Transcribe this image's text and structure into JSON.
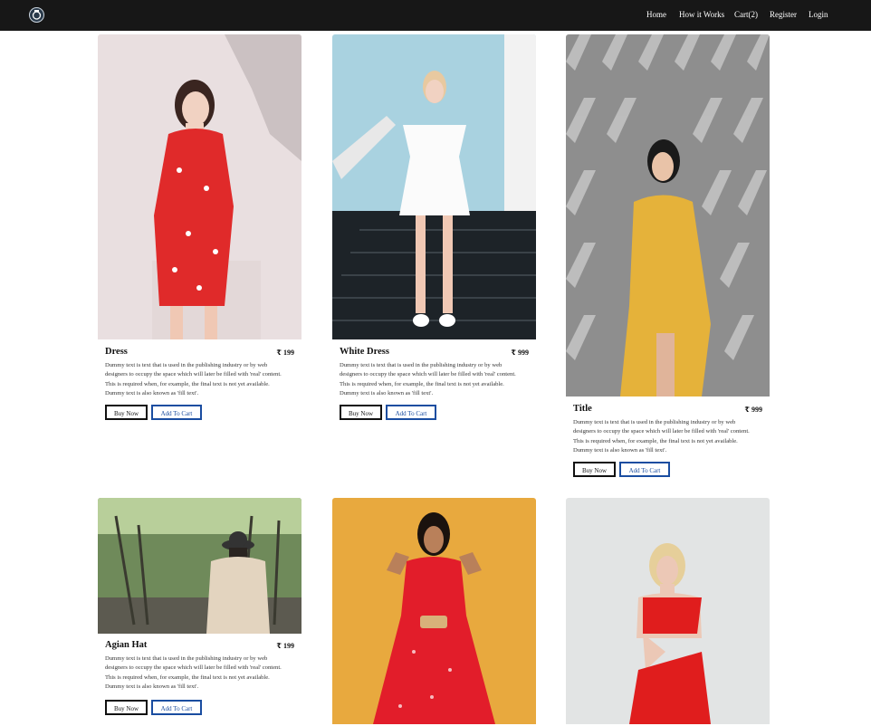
{
  "navbar": {
    "logo_icon": "camera-logo-icon",
    "links": [
      "Home",
      "How it Works",
      "Cart(2)",
      "Register",
      "Login"
    ]
  },
  "products": [
    {
      "title": "Dress",
      "price": "₹ 199",
      "desc": "Dummy text is text that is used in the publishing industry or by web designers to occupy the space which will later be filled with 'real' content. This is required when, for example, the final text is not yet available. Dummy text is also known as 'fill text'.",
      "buy_label": "Buy Now",
      "cart_label": "Add To Cart",
      "image": "woman in red floral dress"
    },
    {
      "title": "White Dress",
      "price": "₹ 999",
      "desc": "Dummy text is text that is used in the publishing industry or by web designers to occupy the space which will later be filled with 'real' content. This is required when, for example, the final text is not yet available. Dummy text is also known as 'fill text'.",
      "buy_label": "Buy Now",
      "cart_label": "Add To Cart",
      "image": "woman in white dress on stairs"
    },
    {
      "title": "Title",
      "price": "₹ 999",
      "desc": "Dummy text is text that is used in the publishing industry or by web designers to occupy the space which will later be filled with 'real' content. This is required when, for example, the final text is not yet available. Dummy text is also known as 'fill text'.",
      "buy_label": "Buy Now",
      "cart_label": "Add To Cart",
      "image": "woman in yellow wrap dress"
    },
    {
      "title": "Agian Hat",
      "price": "₹ 199",
      "desc": "Dummy text is text that is used in the publishing industry or by web designers to occupy the space which will later be filled with 'real' content. This is required when, for example, the final text is not yet available. Dummy text is also known as 'fill text'.",
      "buy_label": "Buy Now",
      "cart_label": "Add To Cart",
      "image": "woman in hat on garden stairs"
    },
    {
      "image": "woman in red dress on yellow background"
    },
    {
      "image": "woman in red one-shoulder top"
    }
  ],
  "colors": {
    "navbar_bg": "#171717",
    "buy_border": "#111111",
    "cart_border": "#1a4da0"
  }
}
